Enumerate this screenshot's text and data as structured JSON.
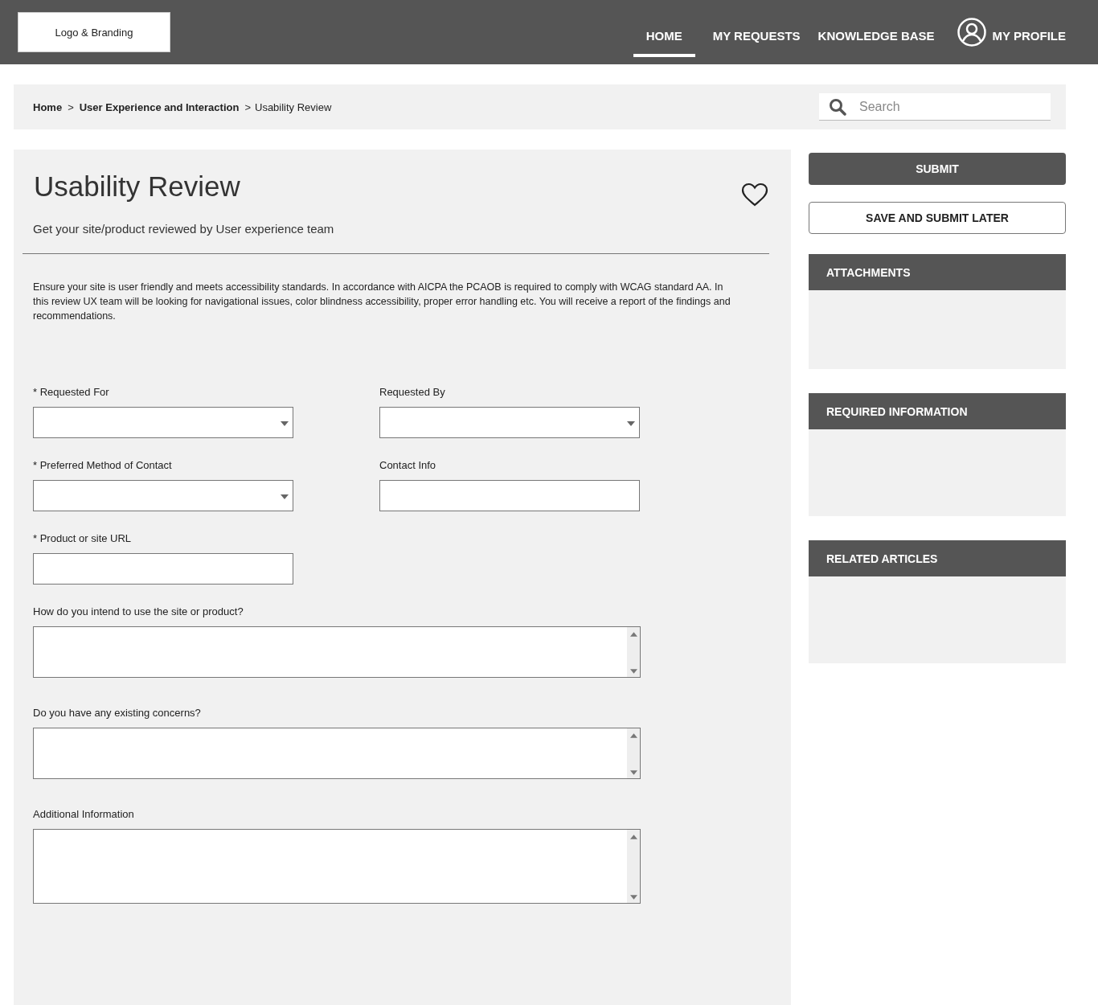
{
  "header": {
    "logo": "Logo & Branding",
    "nav": [
      {
        "label": "HOME",
        "selected": true
      },
      {
        "label": "MY REQUESTS",
        "selected": false
      },
      {
        "label": "KNOWLEDGE BASE",
        "selected": false
      }
    ],
    "profile": "MY PROFILE"
  },
  "breadcrumb_separator": ">",
  "breadcrumb": [
    {
      "label": "Home",
      "current": false
    },
    {
      "label": "User Experience and Interaction",
      "current": false
    },
    {
      "label": "Usability Review",
      "current": true
    }
  ],
  "search": {
    "placeholder": "Search"
  },
  "form": {
    "title": "Usability Review",
    "subtitle": "Get your site/product reviewed by User experience team",
    "favorite": false,
    "description": "Ensure your site is user friendly and meets accessibility standards. In accordance with AICPA the PCAOB is required to comply with WCAG standard AA. In this review UX team will be looking for navigational issues, color blindness accessibility, proper error handling etc. You will receive a report of the findings and recommendations.",
    "fields": [
      {
        "label": "* Requested For",
        "kind": "select"
      },
      {
        "label": "Requested By",
        "kind": "select"
      },
      {
        "label": "*  Preferred Method of Contact",
        "kind": "select"
      },
      {
        "label": "Contact Info",
        "kind": "input"
      },
      {
        "label": "*  Product or site URL",
        "kind": "input"
      },
      {
        "label": "How do you intend to use the site or product?",
        "kind": "textarea"
      },
      {
        "label": "Do you have any existing concerns?",
        "kind": "textarea"
      },
      {
        "label": "Additional Information",
        "kind": "textarea"
      }
    ]
  },
  "actions": [
    {
      "label": "SUBMIT",
      "kind": "primary"
    },
    {
      "label": "SAVE AND SUBMIT LATER",
      "kind": "secondary"
    }
  ],
  "panels": [
    {
      "title": "ATTACHMENTS"
    },
    {
      "title": "REQUIRED INFORMATION"
    },
    {
      "title": "RELATED ARTICLES"
    }
  ]
}
